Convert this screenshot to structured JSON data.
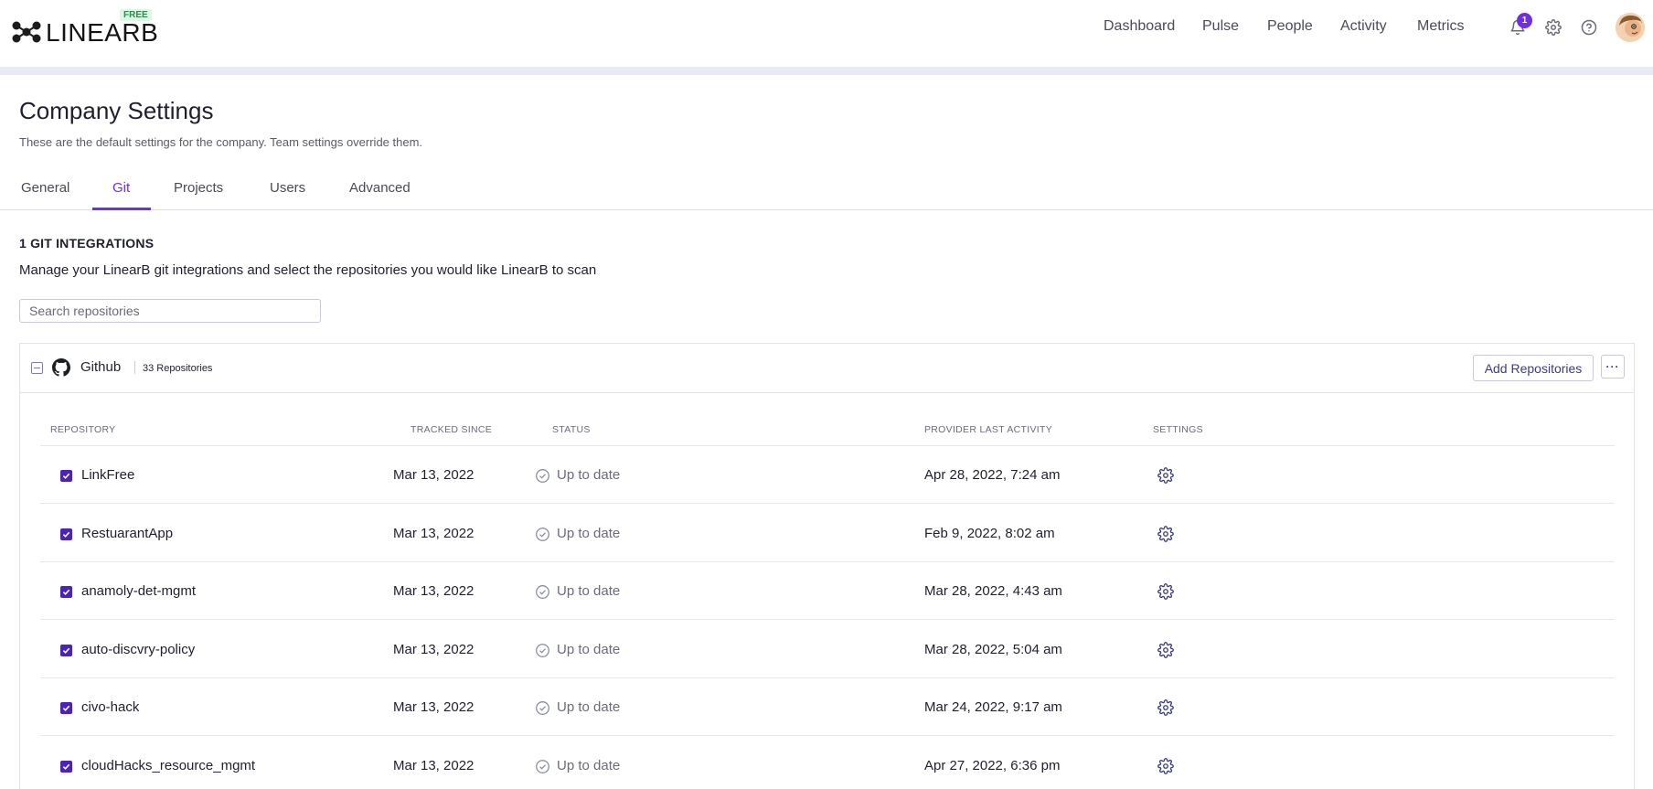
{
  "brand": {
    "name": "LINEARB",
    "plan_badge": "FREE"
  },
  "nav": {
    "links": [
      "Dashboard",
      "Pulse",
      "People",
      "Activity",
      "Metrics"
    ],
    "notification_count": "1",
    "icons": [
      "bell-icon",
      "gear-icon",
      "help-icon",
      "avatar"
    ]
  },
  "page": {
    "title": "Company Settings",
    "subtitle": "These are the default settings for the company. Team settings override them."
  },
  "tabs": [
    {
      "label": "General",
      "active": false
    },
    {
      "label": "Git",
      "active": true
    },
    {
      "label": "Projects",
      "active": false
    },
    {
      "label": "Users",
      "active": false
    },
    {
      "label": "Advanced",
      "active": false
    }
  ],
  "section": {
    "title": "1 GIT INTEGRATIONS",
    "description": "Manage your LinearB git integrations and select the repositories you would like LinearB to scan"
  },
  "search": {
    "placeholder": "Search repositories",
    "value": ""
  },
  "integration": {
    "provider": "Github",
    "repo_count": "33 Repositories",
    "add_button": "Add Repositories",
    "more_button": "···"
  },
  "table": {
    "headers": [
      "REPOSITORY",
      "TRACKED SINCE",
      "STATUS",
      "PROVIDER LAST ACTIVITY",
      "SETTINGS"
    ],
    "rows": [
      {
        "repo": "LinkFree",
        "tracked": "Mar 13, 2022",
        "status": "Up to date",
        "activity": "Apr 28, 2022, 7:24 am",
        "checked": true
      },
      {
        "repo": "RestuarantApp",
        "tracked": "Mar 13, 2022",
        "status": "Up to date",
        "activity": "Feb 9, 2022, 8:02 am",
        "checked": true
      },
      {
        "repo": "anamoly-det-mgmt",
        "tracked": "Mar 13, 2022",
        "status": "Up to date",
        "activity": "Mar 28, 2022, 4:43 am",
        "checked": true
      },
      {
        "repo": "auto-discvry-policy",
        "tracked": "Mar 13, 2022",
        "status": "Up to date",
        "activity": "Mar 28, 2022, 5:04 am",
        "checked": true
      },
      {
        "repo": "civo-hack",
        "tracked": "Mar 13, 2022",
        "status": "Up to date",
        "activity": "Mar 24, 2022, 9:17 am",
        "checked": true
      },
      {
        "repo": "cloudHacks_resource_mgmt",
        "tracked": "Mar 13, 2022",
        "status": "Up to date",
        "activity": "Apr 27, 2022, 6:36 pm",
        "checked": true
      }
    ]
  },
  "colors": {
    "accent": "#6f2ee0",
    "checkbox": "#4a24b8",
    "link": "#3b3b8a"
  }
}
